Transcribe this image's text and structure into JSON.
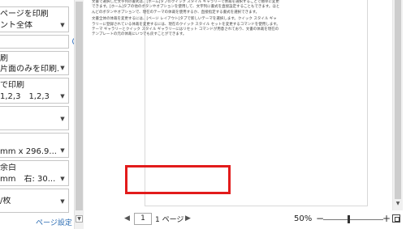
{
  "settings": {
    "print_what": {
      "line1": "ページを印刷",
      "line2": "ント全体"
    },
    "pages_input": {
      "value": "",
      "info_icon": "info-icon"
    },
    "sides": {
      "line1": "刷",
      "line2": "片面のみを印刷..."
    },
    "collate": {
      "line1": "で印刷",
      "line2": "1,2,3　1,2,3"
    },
    "orientation": {
      "line1": ""
    },
    "paper_size": {
      "line1": "mm x 296.9..."
    },
    "margins": {
      "line1": "余白",
      "line2": "mm　右: 30..."
    },
    "pages_per_sheet": {
      "line1": "/枚"
    },
    "page_setup_link": "ページ設定"
  },
  "preview": {
    "doc_paragraphs": [
      "文書で選択した文字列の書式は、[ホーム]タブのクイック スタイル ギャラリーで体裁を選択することで簡単に変更できます。[ホーム]タブの他のボタンやオプションを使用して、文字列に書式を直接設定することもできます。ほとんどのボタンやオプションで、現在のテーマの体裁を使用するか、直接指定する書式を選択できます。",
      "文書全体の体裁を変更するには、[ページ レイアウト]タブで新しいテーマを選択します。クイック スタイル ギャラリーに登録されている体裁を変更するには、現在のクイック スタイル セットを変更するコマンドを使用します。テーマ ギャラリーとクイック スタイル ギャラリーにはリセット コマンドが用意されており、文書の体裁を現在のテンプレートの元の体裁にいつでも戻すことができます。"
    ]
  },
  "status": {
    "prev_icon": "◀",
    "current_page": "1",
    "page_total": "1 ページ",
    "next_icon": "▶",
    "zoom_level": "50%",
    "zoom_minus": "−",
    "zoom_plus": "+",
    "zoom_fraction": 0.5
  },
  "colors": {
    "highlight": "#e21b1b",
    "link": "#2b6cb3"
  }
}
